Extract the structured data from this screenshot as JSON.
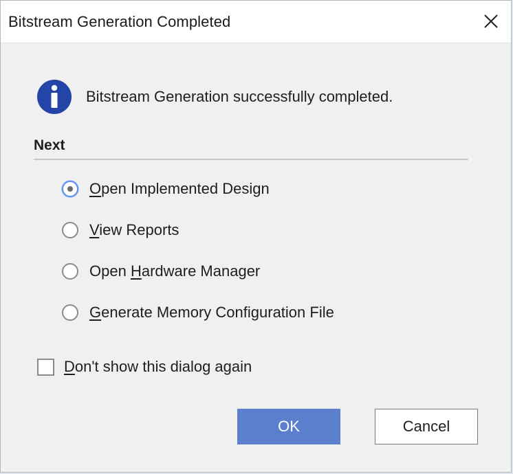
{
  "dialog": {
    "title": "Bitstream Generation Completed",
    "close_icon": "close-icon"
  },
  "info": {
    "icon": "info-icon",
    "message": "Bitstream Generation successfully completed."
  },
  "next": {
    "header": "Next",
    "options": [
      {
        "pre": "",
        "mnemonic": "O",
        "post": "pen Implemented Design",
        "selected": true
      },
      {
        "pre": "",
        "mnemonic": "V",
        "post": "iew Reports",
        "selected": false
      },
      {
        "pre": "Open ",
        "mnemonic": "H",
        "post": "ardware Manager",
        "selected": false
      },
      {
        "pre": "",
        "mnemonic": "G",
        "post": "enerate Memory Configuration File",
        "selected": false
      }
    ]
  },
  "dont_show": {
    "pre": "",
    "mnemonic": "D",
    "post": "on't show this dialog again",
    "checked": false
  },
  "buttons": {
    "ok": "OK",
    "cancel": "Cancel"
  },
  "colors": {
    "ok_button": "#5b7fcc",
    "info_icon": "#2445a8",
    "radio_selected_ring": "#5b8ef0"
  }
}
